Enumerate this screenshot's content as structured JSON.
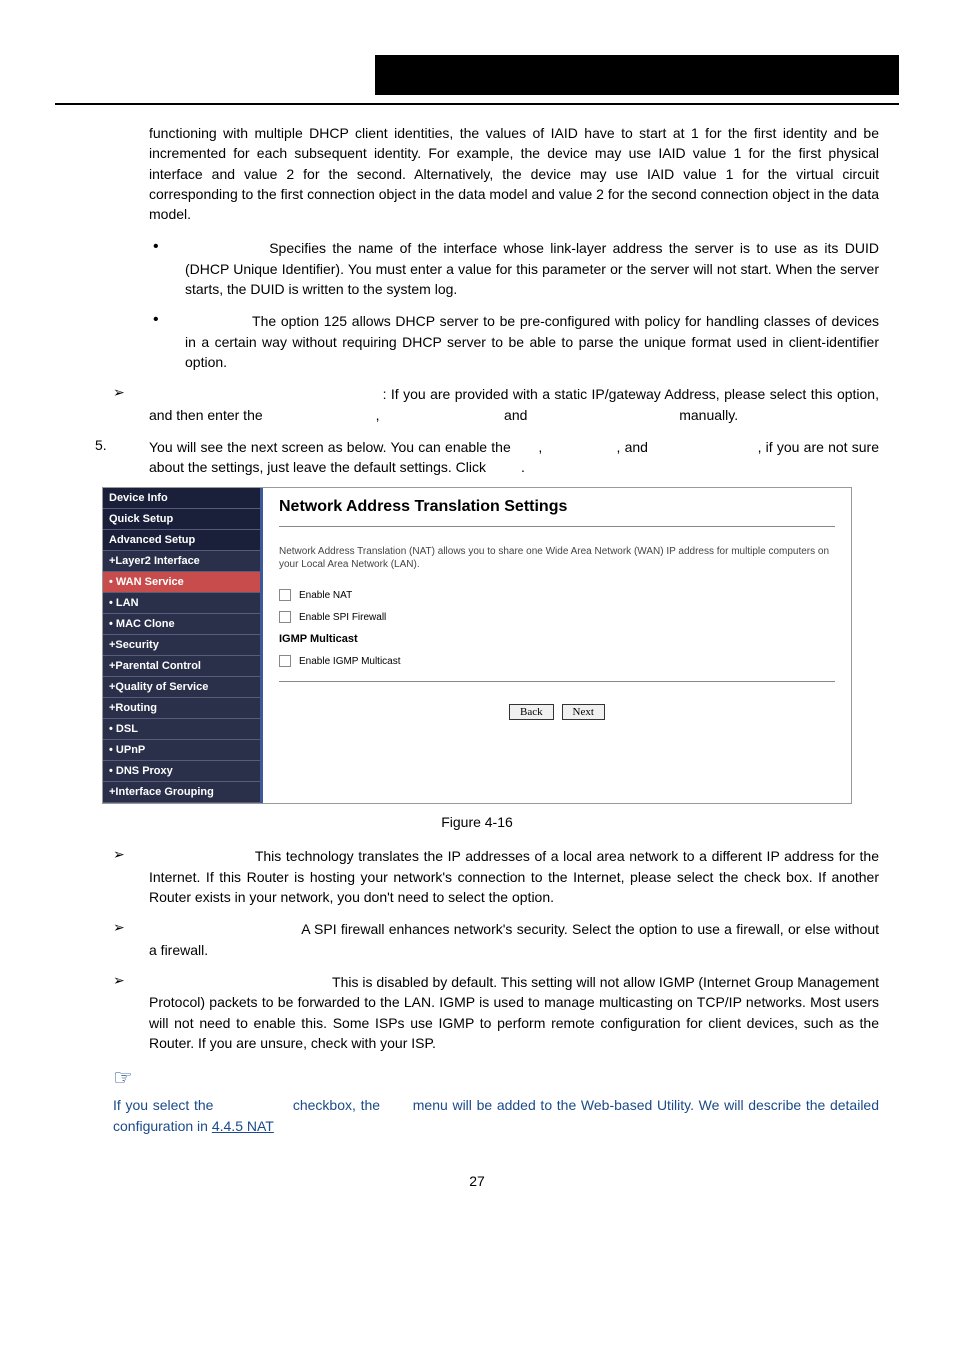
{
  "para1": "functioning with multiple DHCP client identities, the values of IAID have to start at 1 for the first identity and be incremented for each subsequent identity. For example, the device may use IAID value 1 for the first physical interface and value 2 for the second. Alternatively, the device may use IAID value 1 for the virtual circuit corresponding to the first connection object in the data model and value 2 for the second connection object in the data model.",
  "bullet1": "Specifies the name of the interface whose link-layer address the server is to use as its DUID (DHCP Unique Identifier). You must enter a value for this parameter or the server will not start. When the server starts, the DUID is written to the system log.",
  "bullet2": "The option 125 allows DHCP server to be pre-configured with policy for handling classes of devices in a certain way without requiring DHCP server to be able to parse the unique format used in client-identifier option.",
  "arrow1a": ": If you are provided with a static IP/gateway Address, please select this option, and then enter the ",
  "arrow1b": " and ",
  "arrow1c": " manually.",
  "num5a": "You will see the next screen as below. You can enable the ",
  "num5b": ", and ",
  "num5c": ", if you are not sure about the settings, just leave the default settings. Click ",
  "figcap": "Figure 4-16",
  "sidebar": {
    "items": [
      {
        "label": "Device Info",
        "cls": "header"
      },
      {
        "label": "Quick Setup",
        "cls": "header"
      },
      {
        "label": "Advanced Setup",
        "cls": "header"
      },
      {
        "label": "+Layer2 Interface",
        "cls": ""
      },
      {
        "label": "• WAN Service",
        "cls": "selected"
      },
      {
        "label": "• LAN",
        "cls": ""
      },
      {
        "label": "• MAC Clone",
        "cls": ""
      },
      {
        "label": "+Security",
        "cls": ""
      },
      {
        "label": "+Parental Control",
        "cls": ""
      },
      {
        "label": "+Quality of Service",
        "cls": ""
      },
      {
        "label": "+Routing",
        "cls": ""
      },
      {
        "label": "• DSL",
        "cls": ""
      },
      {
        "label": "• UPnP",
        "cls": ""
      },
      {
        "label": "• DNS Proxy",
        "cls": ""
      },
      {
        "label": "+Interface Grouping",
        "cls": ""
      }
    ]
  },
  "panel": {
    "title": "Network Address Translation Settings",
    "desc": "Network Address Translation (NAT) allows you to share one Wide Area Network (WAN) IP address for multiple computers on your Local Area Network (LAN).",
    "chk1": "Enable NAT",
    "chk2": "Enable SPI Firewall",
    "sub": "IGMP Multicast",
    "chk3": "Enable IGMP Multicast",
    "back": "Back",
    "next": "Next"
  },
  "arrow2": "This technology translates the IP addresses of a local area network to a different IP address for the Internet. If this Router is hosting your network's connection to the Internet, please select the check box. If another Router exists in your network, you don't need to select the option.",
  "arrow3": "A SPI firewall enhances network's security. Select the option to use a firewall, or else without a firewall.",
  "arrow4": "This is disabled by default. This setting will not allow IGMP (Internet Group Management Protocol) packets to be forwarded to the LAN. IGMP is used to manage multicasting on TCP/IP networks. Most users will not need to enable this. Some ISPs use IGMP to perform remote configuration for client devices, such as the Router. If you are unsure, check with your ISP.",
  "noteIcon": "☞",
  "note1": "If you select the ",
  "note2": " checkbox, the ",
  "note3": " menu will be added to the Web-based Utility. We will describe the detailed configuration in ",
  "noteLink": "4.4.5 NAT",
  "pageNum": "27"
}
